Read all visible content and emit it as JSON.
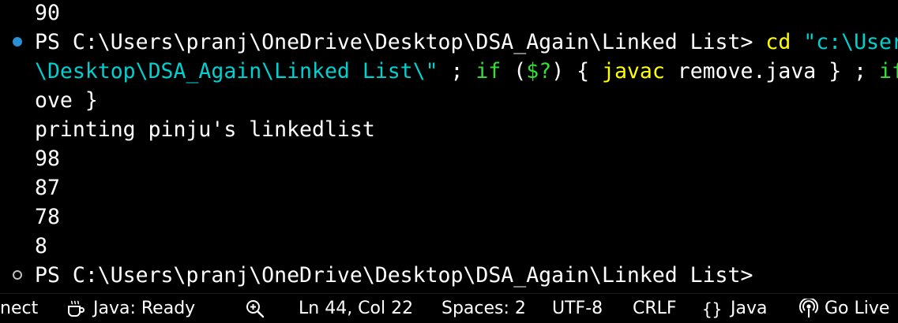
{
  "terminal": {
    "lines": [
      {
        "segments": [
          {
            "text": "90",
            "color": "white"
          }
        ]
      },
      {
        "decoration": "success",
        "segments": [
          {
            "text": "PS C:\\Users\\pranj\\OneDrive\\Desktop\\DSA_Again\\Linked List> ",
            "color": "white"
          },
          {
            "text": "cd",
            "color": "yellow"
          },
          {
            "text": " ",
            "color": "white"
          },
          {
            "text": "\"c:\\User",
            "color": "cyan"
          }
        ]
      },
      {
        "segments": [
          {
            "text": "\\Desktop\\DSA_Again\\Linked List\\\"",
            "color": "cyan"
          },
          {
            "text": " ; ",
            "color": "white"
          },
          {
            "text": "if",
            "color": "green"
          },
          {
            "text": " (",
            "color": "white"
          },
          {
            "text": "$?",
            "color": "green"
          },
          {
            "text": ") { ",
            "color": "white"
          },
          {
            "text": "javac",
            "color": "yellow"
          },
          {
            "text": " remove.java } ; ",
            "color": "white"
          },
          {
            "text": "if",
            "color": "green"
          }
        ]
      },
      {
        "segments": [
          {
            "text": "ove }",
            "color": "white"
          }
        ]
      },
      {
        "segments": [
          {
            "text": "printing pinju's linkedlist",
            "color": "white"
          }
        ]
      },
      {
        "segments": [
          {
            "text": "98",
            "color": "white"
          }
        ]
      },
      {
        "segments": [
          {
            "text": "87",
            "color": "white"
          }
        ]
      },
      {
        "segments": [
          {
            "text": "78",
            "color": "white"
          }
        ]
      },
      {
        "segments": [
          {
            "text": "8",
            "color": "white"
          }
        ]
      },
      {
        "decoration": "default",
        "segments": [
          {
            "text": "PS C:\\Users\\pranj\\OneDrive\\Desktop\\DSA_Again\\Linked List>",
            "color": "white"
          }
        ]
      }
    ]
  },
  "statusbar": {
    "items": [
      {
        "name": "connect-status",
        "text": "nect",
        "icon": null,
        "interactable": true
      },
      {
        "name": "java-status",
        "text": "Java: Ready",
        "icon": "coffee-cup-icon",
        "interactable": true
      },
      {
        "name": "zoom-status",
        "text": "",
        "icon": "zoom-in-icon",
        "interactable": true
      },
      {
        "name": "cursor-position",
        "text": "Ln 44, Col 22",
        "icon": null,
        "interactable": true
      },
      {
        "name": "indentation",
        "text": "Spaces: 2",
        "icon": null,
        "interactable": true
      },
      {
        "name": "encoding",
        "text": "UTF-8",
        "icon": null,
        "interactable": true
      },
      {
        "name": "line-ending",
        "text": "CRLF",
        "icon": null,
        "interactable": true
      },
      {
        "name": "language-mode",
        "text": "Java",
        "icon": "braces-icon",
        "interactable": true
      },
      {
        "name": "go-live-button",
        "text": "Go Live",
        "icon": "broadcast-icon",
        "interactable": true
      }
    ]
  },
  "colors": {
    "white": "#ffffff",
    "yellow": "#ffff00",
    "cyan": "#00d0d0",
    "green": "#33e033",
    "success_dot": "#2b8fd6",
    "default_dot": "#bfbfbf",
    "background": "#000000"
  }
}
